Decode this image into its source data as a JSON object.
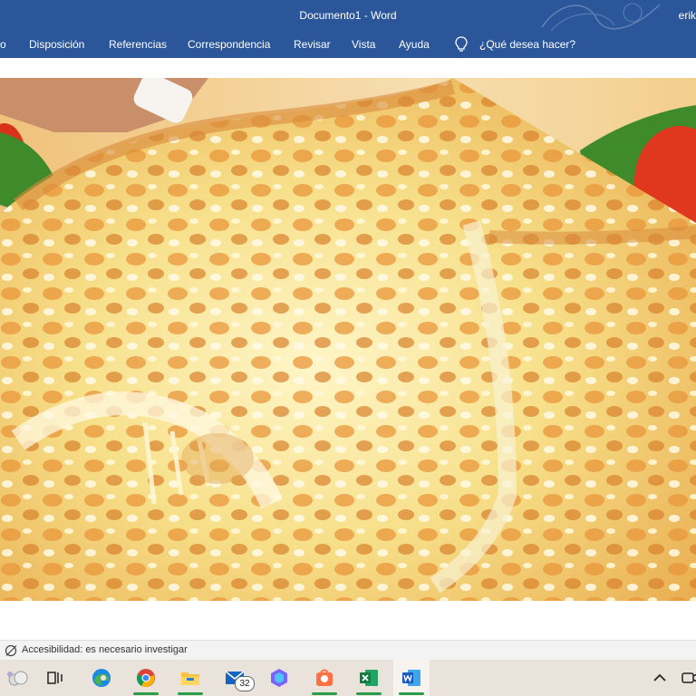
{
  "titlebar": {
    "document_title": "Documento1  -  Word",
    "user_name": "erik"
  },
  "ribbon": {
    "tabs": [
      {
        "label": "o"
      },
      {
        "label": "Disposición"
      },
      {
        "label": "Referencias"
      },
      {
        "label": "Correspondencia"
      },
      {
        "label": "Revisar"
      },
      {
        "label": "Vista"
      },
      {
        "label": "Ayuda"
      }
    ],
    "tell_me": "¿Qué desea hacer?"
  },
  "statusbar": {
    "accessibility": "Accesibilidad: es necesario investigar"
  },
  "taskbar": {
    "mail_badge": "32"
  },
  "colors": {
    "word_blue": "#2b579a",
    "taskbar_bg": "#e9e3dc"
  }
}
